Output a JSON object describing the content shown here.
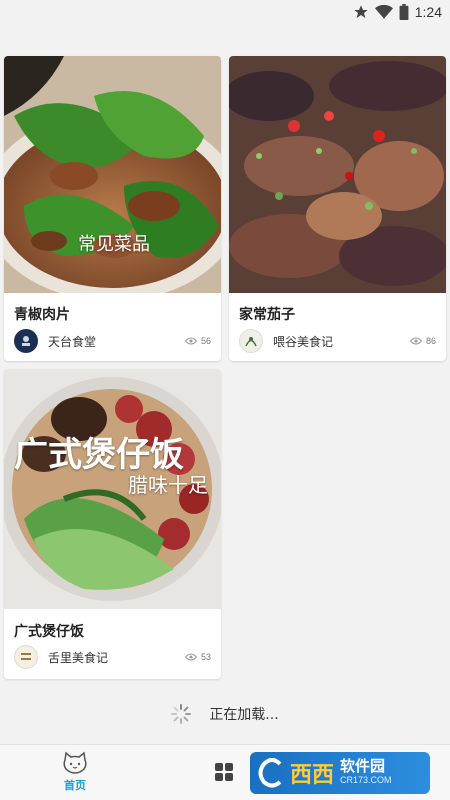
{
  "status_bar": {
    "time": "1:24"
  },
  "cards": [
    {
      "title": "青椒肉片",
      "author": "天台食堂",
      "views": "56",
      "image_caption": "常见菜品"
    },
    {
      "title": "家常茄子",
      "author": "喂谷美食记",
      "views": "86"
    },
    {
      "title": "广式煲仔饭",
      "author": "舌里美食记",
      "views": "53",
      "image_caption": "广式煲仔饭",
      "image_subcaption": "腊味十足"
    }
  ],
  "loading_text": "正在加载...",
  "tabbar": {
    "home_label": "首页"
  },
  "watermark": {
    "logo": "西西",
    "main": "软件园",
    "sub": "CR173.COM"
  },
  "colors": {
    "accent": "#1e9bd8",
    "background": "#f2f2f2"
  }
}
